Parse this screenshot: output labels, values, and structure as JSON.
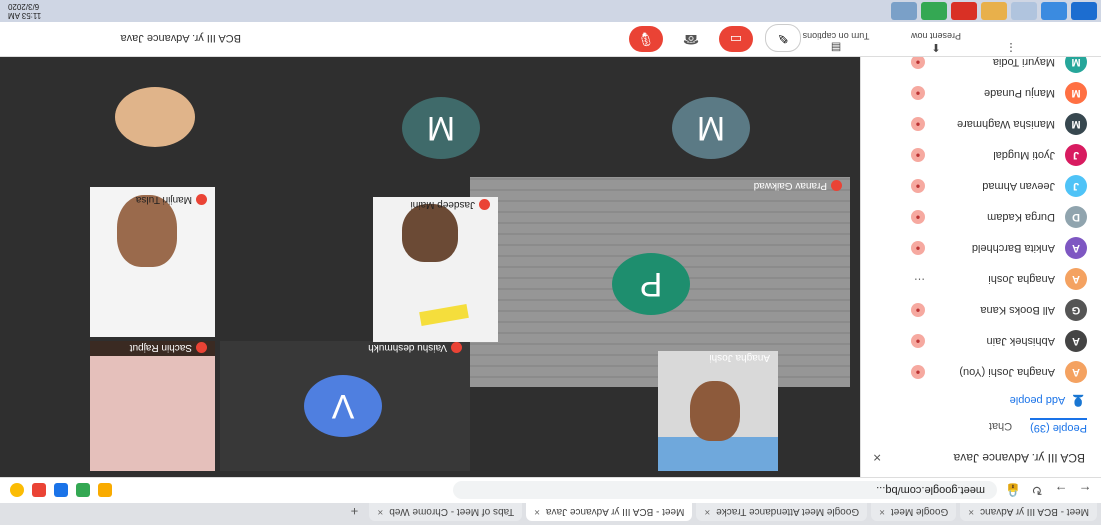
{
  "browser": {
    "tabs": [
      {
        "label": "Meet - BCA III yr Advanc",
        "active": false
      },
      {
        "label": "Google Meet",
        "active": false
      },
      {
        "label": "Google Meet Attendance Tracke",
        "active": false
      },
      {
        "label": "Meet - BCA III yr Advance Java",
        "active": true
      },
      {
        "label": "Tabs of Meet - Chrome Web",
        "active": false
      }
    ],
    "new_tab": "+",
    "url": "meet.google.com/bq..."
  },
  "meeting": {
    "title": "BCA III yr. Advance Java",
    "present_now": "Present now",
    "captions": "Turn on captions",
    "more": "⋮"
  },
  "side_panel": {
    "title": "BCA III yr. Advance Java",
    "tab_people": "People (39)",
    "tab_chat": "Chat",
    "add_people": "Add people",
    "participants": [
      {
        "initial": "A",
        "name": "Anagha Joshi (You)",
        "color": "#f4a261"
      },
      {
        "initial": "A",
        "name": "Abhishek Jain",
        "color": "#444444"
      },
      {
        "initial": "G",
        "name": "All Books Kana",
        "color": "#555555"
      },
      {
        "initial": "A",
        "name": "Anagha Joshi",
        "color": "#f4a261"
      },
      {
        "initial": "A",
        "name": "Ankita Barchheld",
        "color": "#7e57c2"
      },
      {
        "initial": "D",
        "name": "Durga Kadam",
        "color": "#90a4ae"
      },
      {
        "initial": "J",
        "name": "Jeevan Ahmad",
        "color": "#4fc3f7"
      },
      {
        "initial": "J",
        "name": "Jyoti Mugdal",
        "color": "#d81b60"
      },
      {
        "initial": "M",
        "name": "Manisha Waghmare",
        "color": "#37474f"
      },
      {
        "initial": "M",
        "name": "Manju Punade",
        "color": "#ff7043"
      },
      {
        "initial": "M",
        "name": "Mayuri Todia",
        "color": "#26a69a"
      }
    ]
  },
  "tiles": [
    {
      "name": "Pranav Gaikwad",
      "initial": "P",
      "color": "#1e8e6e"
    },
    {
      "name": "Anagha Joshi",
      "initial": "",
      "color": ""
    },
    {
      "name": "Vaishu deshmukh",
      "initial": "V",
      "color": "#4f7fe0"
    },
    {
      "name": "Sachin Rajput",
      "initial": "",
      "color": ""
    },
    {
      "name": "Jasdeep Maini",
      "initial": "",
      "color": ""
    },
    {
      "name": "Manjiri Tulsa",
      "initial": "",
      "color": ""
    },
    {
      "name": "",
      "initial": "M",
      "color": "#3f6a6a"
    },
    {
      "name": "",
      "initial": "M",
      "color": "#5b7a85"
    }
  ],
  "taskbar": {
    "time": "11:53 AM",
    "date": "6/3/2020"
  }
}
